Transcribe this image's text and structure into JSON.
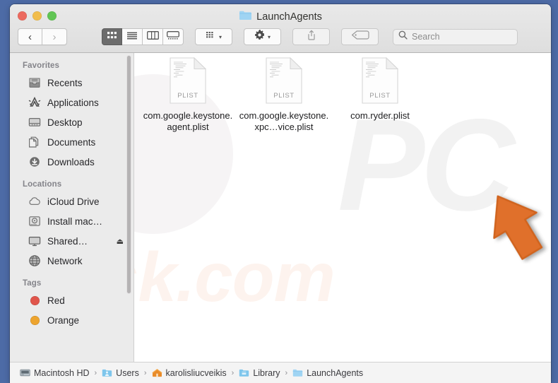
{
  "window": {
    "title": "LaunchAgents",
    "title_icon": "folder-icon",
    "traffic_lights": [
      {
        "name": "close",
        "color": "#ec6a5f"
      },
      {
        "name": "minimize",
        "color": "#f1bd4c"
      },
      {
        "name": "maximize",
        "color": "#61c554"
      }
    ],
    "page_background": "#4d6ba6"
  },
  "toolbar": {
    "back_label": "‹",
    "forward_label": "›",
    "view_buttons": [
      {
        "name": "icon-view",
        "selected": true
      },
      {
        "name": "list-view",
        "selected": false
      },
      {
        "name": "column-view",
        "selected": false
      },
      {
        "name": "gallery-view",
        "selected": false
      }
    ],
    "arrange_label": "arrange-by-icon",
    "action_label": "gear-icon",
    "share_label": "share-icon",
    "tags_label": "tag-icon",
    "caret": "▾"
  },
  "search": {
    "placeholder": "Search",
    "value": "",
    "icon": "search-icon"
  },
  "sidebar": {
    "sections": [
      {
        "header": "Favorites",
        "items": [
          {
            "label": "Recents",
            "icon": "recents-icon"
          },
          {
            "label": "Applications",
            "icon": "applications-icon"
          },
          {
            "label": "Desktop",
            "icon": "desktop-icon"
          },
          {
            "label": "Documents",
            "icon": "documents-icon"
          },
          {
            "label": "Downloads",
            "icon": "downloads-icon"
          }
        ]
      },
      {
        "header": "Locations",
        "items": [
          {
            "label": "iCloud Drive",
            "icon": "cloud-icon"
          },
          {
            "label": "Install mac…",
            "icon": "disk-icon"
          },
          {
            "label": "Shared…",
            "icon": "display-icon",
            "eject": "⏏"
          },
          {
            "label": "Network",
            "icon": "globe-icon"
          }
        ]
      },
      {
        "header": "Tags",
        "items": [
          {
            "label": "Red",
            "icon": "tag-dot",
            "color": "#e0554b"
          },
          {
            "label": "Orange",
            "icon": "tag-dot",
            "color": "#eda42e"
          }
        ]
      }
    ]
  },
  "main": {
    "files": [
      {
        "name": "com.google.keystone.agent.plist",
        "kind": "PLIST",
        "icon": "plist-document-icon"
      },
      {
        "name": "com.google.keystone.xpc…vice.plist",
        "kind": "PLIST",
        "icon": "plist-document-icon"
      },
      {
        "name": "com.ryder.plist",
        "kind": "PLIST",
        "icon": "plist-document-icon"
      }
    ],
    "annotation": {
      "name": "orange-arrow-cursor",
      "color": "#e0702b",
      "points_at": "com.ryder.plist"
    },
    "watermark": {
      "top_text": "PC",
      "bottom_text": "sk.com"
    }
  },
  "pathbar": {
    "crumbs": [
      {
        "label": "Macintosh HD",
        "icon": "hard-drive-icon"
      },
      {
        "label": "Users",
        "icon": "users-folder-icon"
      },
      {
        "label": "karolisliucveikis",
        "icon": "home-folder-icon"
      },
      {
        "label": "Library",
        "icon": "library-folder-icon"
      },
      {
        "label": "LaunchAgents",
        "icon": "folder-icon"
      }
    ],
    "separator": "›"
  }
}
